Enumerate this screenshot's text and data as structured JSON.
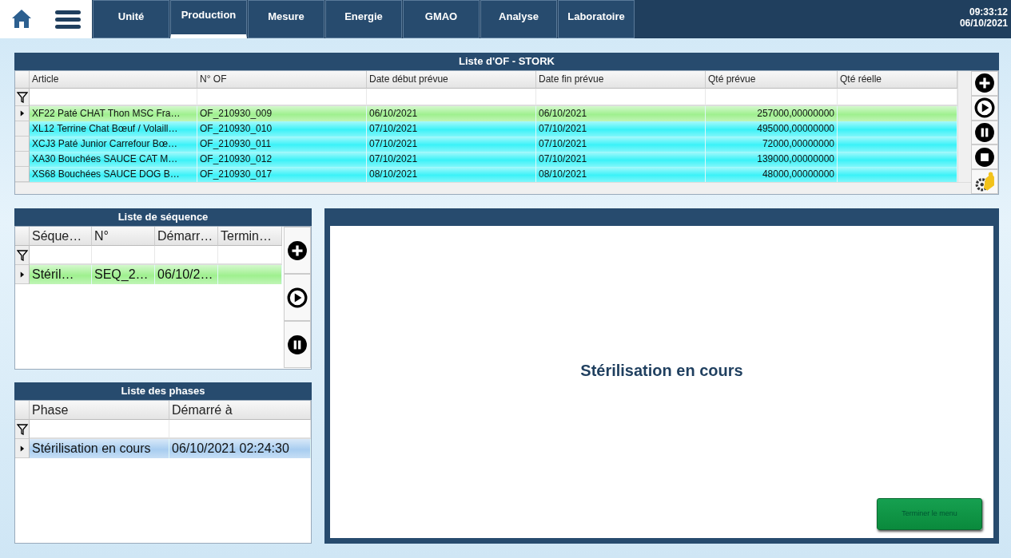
{
  "topbar": {
    "tabs": [
      {
        "label": "Unité",
        "selected": false
      },
      {
        "label": "Production",
        "selected": true
      },
      {
        "label": "Mesure",
        "selected": false
      },
      {
        "label": "Energie",
        "selected": false
      },
      {
        "label": "GMAO",
        "selected": false
      },
      {
        "label": "Analyse",
        "selected": false
      },
      {
        "label": "Laboratoire",
        "selected": false
      }
    ],
    "time": "09:33:12",
    "date": "06/10/2021"
  },
  "of_list": {
    "title": "Liste d'OF - STORK",
    "columns": [
      "Article",
      "N° OF",
      "Date début prévue",
      "Date fin prévue",
      "Qté prévue",
      "Qté réelle"
    ],
    "rows": [
      {
        "cells": [
          "XF22 Paté CHAT Thon MSC Fra…",
          "OF_210930_009",
          "06/10/2021",
          "06/10/2021",
          "257000,00000000"
        ],
        "color": "#9ff08f",
        "selected": true
      },
      {
        "cells": [
          "XL12 Terrine Chat Bœuf  / Volaill…",
          "OF_210930_010",
          "07/10/2021",
          "07/10/2021",
          "495000,00000000"
        ],
        "color": "#3cf2f8",
        "selected": false
      },
      {
        "cells": [
          "XCJ3 Paté Junior Carrefour Bœ…",
          "OF_210930_011",
          "07/10/2021",
          "07/10/2021",
          "72000,00000000"
        ],
        "color": "#3cf2f8",
        "selected": false
      },
      {
        "cells": [
          "XA30 Bouchées SAUCE CAT M…",
          "OF_210930_012",
          "07/10/2021",
          "07/10/2021",
          "139000,00000000"
        ],
        "color": "#3cf2f8",
        "selected": false
      },
      {
        "cells": [
          "XS68 Bouchées SAUCE DOG B…",
          "OF_210930_017",
          "08/10/2021",
          "08/10/2021",
          "48000,00000000"
        ],
        "color": "#3cf2f8",
        "selected": false
      }
    ],
    "actions": [
      {
        "kind": "add"
      },
      {
        "kind": "play"
      },
      {
        "kind": "pause"
      },
      {
        "kind": "stop"
      },
      {
        "kind": "settings"
      }
    ]
  },
  "sequence_list": {
    "title": "Liste de séquence",
    "columns": [
      "Séque…",
      "N°",
      "Démarr…",
      "Termin…"
    ],
    "rows": [
      {
        "cells": [
          "Stéril…",
          "SEQ_2…",
          "06/10/2…"
        ],
        "color": "#9ff08f",
        "selected": true
      }
    ],
    "actions": [
      {
        "kind": "add"
      },
      {
        "kind": "play"
      },
      {
        "kind": "pause"
      }
    ]
  },
  "phase_list": {
    "title": "Liste des phases",
    "columns": [
      "Phase",
      "Démarré à"
    ],
    "rows": [
      {
        "cells": [
          "Stérilisation en cours",
          "06/10/2021 02:24:30"
        ],
        "color": "#a8cdf0",
        "selected": true
      }
    ]
  },
  "detail": {
    "status": "Stérilisation en cours",
    "button": "Terminer le menu"
  }
}
